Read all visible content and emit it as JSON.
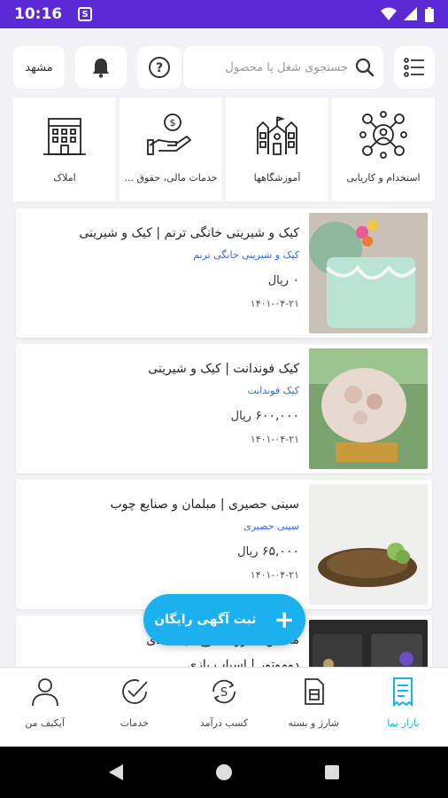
{
  "status": {
    "time": "10:16",
    "s_icon": "S"
  },
  "top_bar": {
    "city": "مشهد",
    "search_placeholder": "جستجوی شغل یا محصول"
  },
  "categories": [
    {
      "label": "املاک",
      "icon": "building-icon"
    },
    {
      "label": "خدمات مالی، حقوق ...",
      "icon": "money-hand-icon"
    },
    {
      "label": "آموزشگاهها",
      "icon": "school-icon"
    },
    {
      "label": "استخدام و کاریابی",
      "icon": "network-people-icon"
    }
  ],
  "listings": [
    {
      "title": "کیک و شیرینی خانگی ترنم | کیک و شیرینی",
      "subtitle": "کیک و شیرینی خانگی ترنم",
      "price": "۰",
      "currency": "ریال",
      "date": "۱۴۰۱-۰۴-۲۱"
    },
    {
      "title": "کیک فوندانت | کیک و شیرینی",
      "subtitle": "کیک فوندانت",
      "price": "۶۰۰,۰۰۰",
      "currency": "ریال",
      "date": "۱۴۰۱-۰۴-۲۱"
    },
    {
      "title": "سینی حصیری | مبلمان و صنایع چوب",
      "subtitle": "سینی حصیری",
      "price": "۶۵,۰۰۰",
      "currency": "ریال",
      "date": "۱۴۰۱-۰۴-۲۱"
    },
    {
      "title": "ماشین شارژی جرخ ال ای دی",
      "subtitle": "دوموتور | اسباب بازی",
      "price": "",
      "currency": "",
      "date": ""
    }
  ],
  "fab": {
    "label": "ثبت آگهی رایگان"
  },
  "bottom_nav": [
    {
      "label": "آیکیف من",
      "icon": "person-icon"
    },
    {
      "label": "خدمات",
      "icon": "check-circle-icon"
    },
    {
      "label": "کسب درآمد",
      "icon": "coin-refresh-icon"
    },
    {
      "label": "شارژ و بسته",
      "icon": "sim-card-icon"
    },
    {
      "label": "بازار نما",
      "icon": "receipt-icon"
    }
  ],
  "colors": {
    "status_bar": "#5a2ad6",
    "accent": "#1bb0ee",
    "link": "#2f6bd9"
  }
}
